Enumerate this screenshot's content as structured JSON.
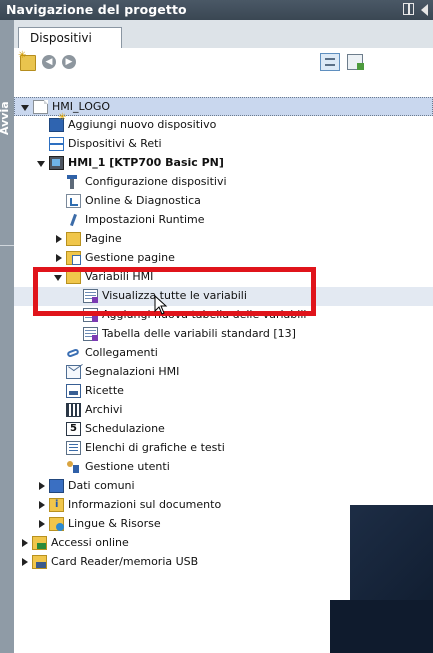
{
  "title": "Navigazione del progetto",
  "sidebar_label": "Avvia",
  "tab": "Dispositivi",
  "tree": [
    {
      "label": "HMI_LOGO",
      "level": 0,
      "toggle": "open",
      "icon": "project-icon",
      "bold": false,
      "selected": true
    },
    {
      "label": "Aggiungi nuovo dispositivo",
      "level": 1,
      "toggle": "none",
      "icon": "add-device-icon"
    },
    {
      "label": "Dispositivi & Reti",
      "level": 1,
      "toggle": "none",
      "icon": "network-icon"
    },
    {
      "label": "HMI_1 [KTP700 Basic PN]",
      "level": 1,
      "toggle": "open",
      "icon": "hmi-device-icon",
      "bold": true
    },
    {
      "label": "Configurazione dispositivi",
      "level": 2,
      "toggle": "none",
      "icon": "device-config-icon"
    },
    {
      "label": "Online & Diagnostica",
      "level": 2,
      "toggle": "none",
      "icon": "diagnostics-icon"
    },
    {
      "label": "Impostazioni Runtime",
      "level": 2,
      "toggle": "none",
      "icon": "wrench-icon"
    },
    {
      "label": "Pagine",
      "level": 2,
      "toggle": "closed",
      "icon": "folder-icon"
    },
    {
      "label": "Gestione pagine",
      "level": 2,
      "toggle": "closed",
      "icon": "screen-management-icon"
    },
    {
      "label": "Variabili HMI",
      "level": 2,
      "toggle": "open",
      "icon": "tag-folder-icon"
    },
    {
      "label": "Visualizza tutte le variabili",
      "level": 3,
      "toggle": "none",
      "icon": "tag-table-icon",
      "hover": true
    },
    {
      "label": "Aggiungi nuova tabella delle variabili",
      "level": 3,
      "toggle": "none",
      "icon": "tag-table-icon"
    },
    {
      "label": "Tabella delle variabili standard [13]",
      "level": 3,
      "toggle": "none",
      "icon": "tag-table-icon"
    },
    {
      "label": "Collegamenti",
      "level": 2,
      "toggle": "none",
      "icon": "connections-icon"
    },
    {
      "label": "Segnalazioni HMI",
      "level": 2,
      "toggle": "none",
      "icon": "alarms-icon"
    },
    {
      "label": "Ricette",
      "level": 2,
      "toggle": "none",
      "icon": "recipes-icon"
    },
    {
      "label": "Archivi",
      "level": 2,
      "toggle": "none",
      "icon": "archives-icon"
    },
    {
      "label": "Schedulazione",
      "level": 2,
      "toggle": "none",
      "icon": "scheduler-icon"
    },
    {
      "label": "Elenchi di grafiche e testi",
      "level": 2,
      "toggle": "none",
      "icon": "text-lists-icon"
    },
    {
      "label": "Gestione utenti",
      "level": 2,
      "toggle": "none",
      "icon": "users-icon"
    },
    {
      "label": "Dati comuni",
      "level": 1,
      "toggle": "closed",
      "icon": "common-data-icon"
    },
    {
      "label": "Informazioni sul documento",
      "level": 1,
      "toggle": "closed",
      "icon": "document-info-icon"
    },
    {
      "label": "Lingue & Risorse",
      "level": 1,
      "toggle": "closed",
      "icon": "languages-icon"
    },
    {
      "label": "Accessi online",
      "level": 0,
      "toggle": "closed",
      "icon": "online-access-icon"
    },
    {
      "label": "Card Reader/memoria USB",
      "level": 0,
      "toggle": "closed",
      "icon": "card-reader-icon"
    }
  ]
}
